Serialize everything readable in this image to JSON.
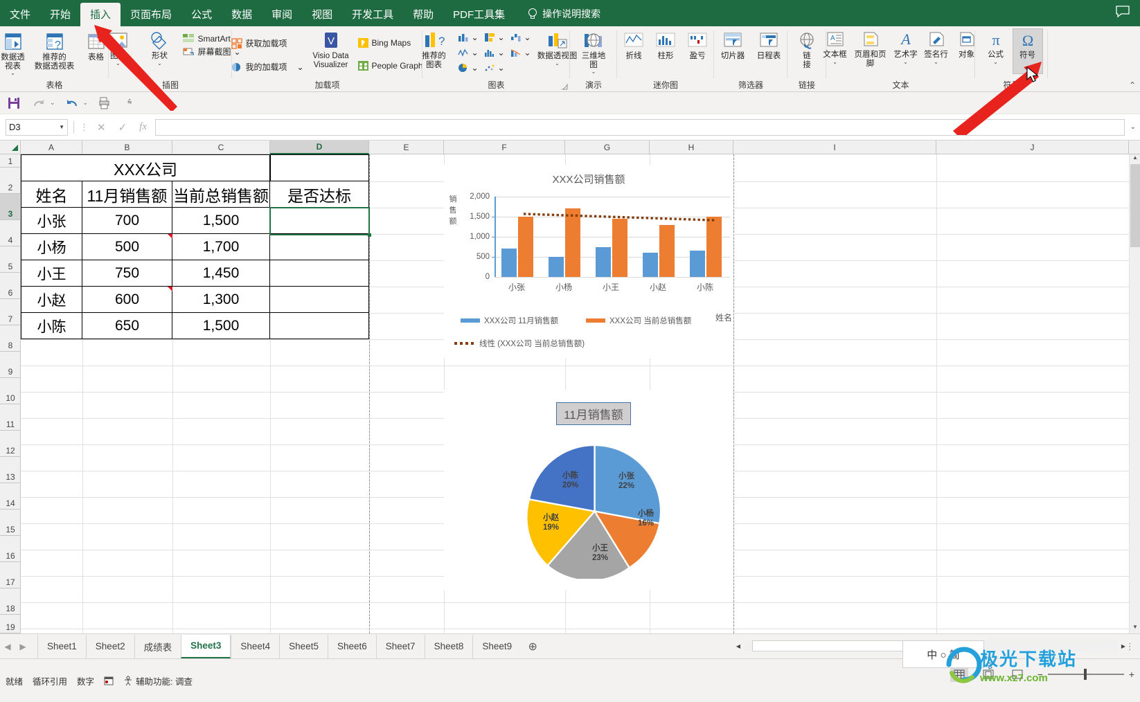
{
  "app": {
    "tabs": [
      {
        "label": "文件",
        "active": false
      },
      {
        "label": "开始",
        "active": false
      },
      {
        "label": "插入",
        "active": true
      },
      {
        "label": "页面布局",
        "active": false
      },
      {
        "label": "公式",
        "active": false
      },
      {
        "label": "数据",
        "active": false
      },
      {
        "label": "审阅",
        "active": false
      },
      {
        "label": "视图",
        "active": false
      },
      {
        "label": "开发工具",
        "active": false
      },
      {
        "label": "帮助",
        "active": false
      },
      {
        "label": "PDF工具集",
        "active": false
      }
    ],
    "tell_me": "操作说明搜索"
  },
  "ribbon": {
    "groups": [
      {
        "name": "表格",
        "big": [
          {
            "label": "数据透\n视表",
            "caret": true
          },
          {
            "label": "推荐的\n数据透视表",
            "caret": false
          },
          {
            "label": "表格",
            "caret": false
          }
        ]
      },
      {
        "name": "插图",
        "big": [
          {
            "label": "图片",
            "caret": true
          },
          {
            "label": "形状",
            "caret": true
          }
        ],
        "small": [
          {
            "label": "SmartArt",
            "caret": false
          },
          {
            "label": "屏幕截图",
            "caret": true
          }
        ]
      },
      {
        "name": "加载项",
        "small": [
          {
            "label": "获取加载项",
            "caret": false
          },
          {
            "label": "我的加载项",
            "caret": true
          }
        ],
        "big": [
          {
            "label": "Visio Data\nVisualizer",
            "caret": false
          }
        ],
        "small2": [
          {
            "label": "Bing Maps",
            "caret": false
          },
          {
            "label": "People Graph",
            "caret": false
          }
        ]
      },
      {
        "name": "图表",
        "big": [
          {
            "label": "推荐的\n图表",
            "caret": false
          },
          {
            "label": "数据透视图",
            "caret": true
          }
        ],
        "minis": [
          "柱形图",
          "折线图",
          "饼图",
          "条形图",
          "面积图",
          "散点图",
          "瀑布图",
          "组合图",
          "树状图"
        ]
      },
      {
        "name": "演示",
        "big": [
          {
            "label": "三维地\n图",
            "caret": true
          }
        ]
      },
      {
        "name": "迷你图",
        "big": [
          {
            "label": "折线",
            "caret": false
          },
          {
            "label": "柱形",
            "caret": false
          },
          {
            "label": "盈亏",
            "caret": false
          }
        ]
      },
      {
        "name": "筛选器",
        "big": [
          {
            "label": "切片器",
            "caret": false
          },
          {
            "label": "日程表",
            "caret": false
          }
        ]
      },
      {
        "name": "链接",
        "big": [
          {
            "label": "链\n接",
            "caret": false
          }
        ]
      },
      {
        "name": "文本",
        "big": [
          {
            "label": "文本框",
            "caret": true
          },
          {
            "label": "页眉和页脚",
            "caret": false
          },
          {
            "label": "艺术字",
            "caret": true
          },
          {
            "label": "签名行",
            "caret": true
          },
          {
            "label": "对象",
            "caret": false
          }
        ]
      },
      {
        "name": "符号",
        "big": [
          {
            "label": "公式",
            "caret": true
          },
          {
            "label": "符号",
            "caret": false
          }
        ]
      }
    ]
  },
  "formula_bar": {
    "name_box": "D3",
    "formula_value": "",
    "cancel_icon": "✕",
    "confirm_icon": "✓",
    "fx_icon": "fx"
  },
  "grid": {
    "columns": [
      "A",
      "B",
      "C",
      "D",
      "E",
      "F",
      "G",
      "H",
      "I",
      "J"
    ],
    "selected_column": "D",
    "rows": [
      "1",
      "2",
      "3",
      "4",
      "5",
      "6",
      "7",
      "8",
      "9",
      "10",
      "11",
      "12",
      "13",
      "14",
      "15",
      "16",
      "17",
      "18",
      "19"
    ],
    "selected_row": "3",
    "title_cell": "XXX公司",
    "headers": [
      "姓名",
      "11月销售额",
      "当前总销售额",
      "是否达标"
    ],
    "data": [
      {
        "name": "小张",
        "nov": "700",
        "total": "1,500",
        "pass": ""
      },
      {
        "name": "小杨",
        "nov": "500",
        "total": "1,700",
        "pass": ""
      },
      {
        "name": "小王",
        "nov": "750",
        "total": "1,450",
        "pass": ""
      },
      {
        "name": "小赵",
        "nov": "600",
        "total": "1,300",
        "pass": ""
      },
      {
        "name": "小陈",
        "nov": "650",
        "total": "1,500",
        "pass": ""
      }
    ]
  },
  "chart_data": [
    {
      "type": "bar",
      "title": "XXX公司销售额",
      "xlabel": "姓名",
      "ylabel": "销售额",
      "categories": [
        "小张",
        "小杨",
        "小王",
        "小赵",
        "小陈"
      ],
      "series": [
        {
          "name": "XXX公司 11月销售额",
          "color": "#5b9bd5",
          "values": [
            700,
            500,
            750,
            600,
            650
          ]
        },
        {
          "name": "XXX公司 当前总销售额",
          "color": "#ed7d31",
          "values": [
            1500,
            1700,
            1450,
            1300,
            1500
          ]
        }
      ],
      "trendline": {
        "name": "线性 (XXX公司 当前总销售额)",
        "color": "#843c0c",
        "start": 1570,
        "end": 1410
      },
      "ylim": [
        0,
        2000
      ],
      "yticks": [
        "0",
        "500",
        "1,000",
        "1,500",
        "2,000"
      ],
      "grid": true,
      "legend_position": "bottom"
    },
    {
      "type": "pie",
      "title": "11月销售额",
      "categories": [
        "小张",
        "小杨",
        "小王",
        "小赵",
        "小陈"
      ],
      "values": [
        700,
        500,
        750,
        600,
        650
      ],
      "percent_labels": [
        "22%",
        "16%",
        "23%",
        "19%",
        "20%"
      ],
      "colors": [
        "#5b9bd5",
        "#ed7d31",
        "#a5a5a5",
        "#ffc000",
        "#4472c4"
      ],
      "legend_position": "none"
    }
  ],
  "sheet_tabs": {
    "prev_icon": "◀",
    "next_icon": "▶",
    "tabs": [
      "Sheet1",
      "Sheet2",
      "成绩表",
      "Sheet3",
      "Sheet4",
      "Sheet5",
      "Sheet6",
      "Sheet7",
      "Sheet8",
      "Sheet9"
    ],
    "active": "Sheet3",
    "add_label": "⊕"
  },
  "status_bar": {
    "ready": "就绪",
    "circular": "循环引用",
    "number": "数字",
    "accessibility": "辅助功能: 调查",
    "zoom_level": "",
    "ime": "中 ○ 简"
  },
  "watermark": {
    "title": "极光下载站",
    "url": "www.xz7.com"
  }
}
